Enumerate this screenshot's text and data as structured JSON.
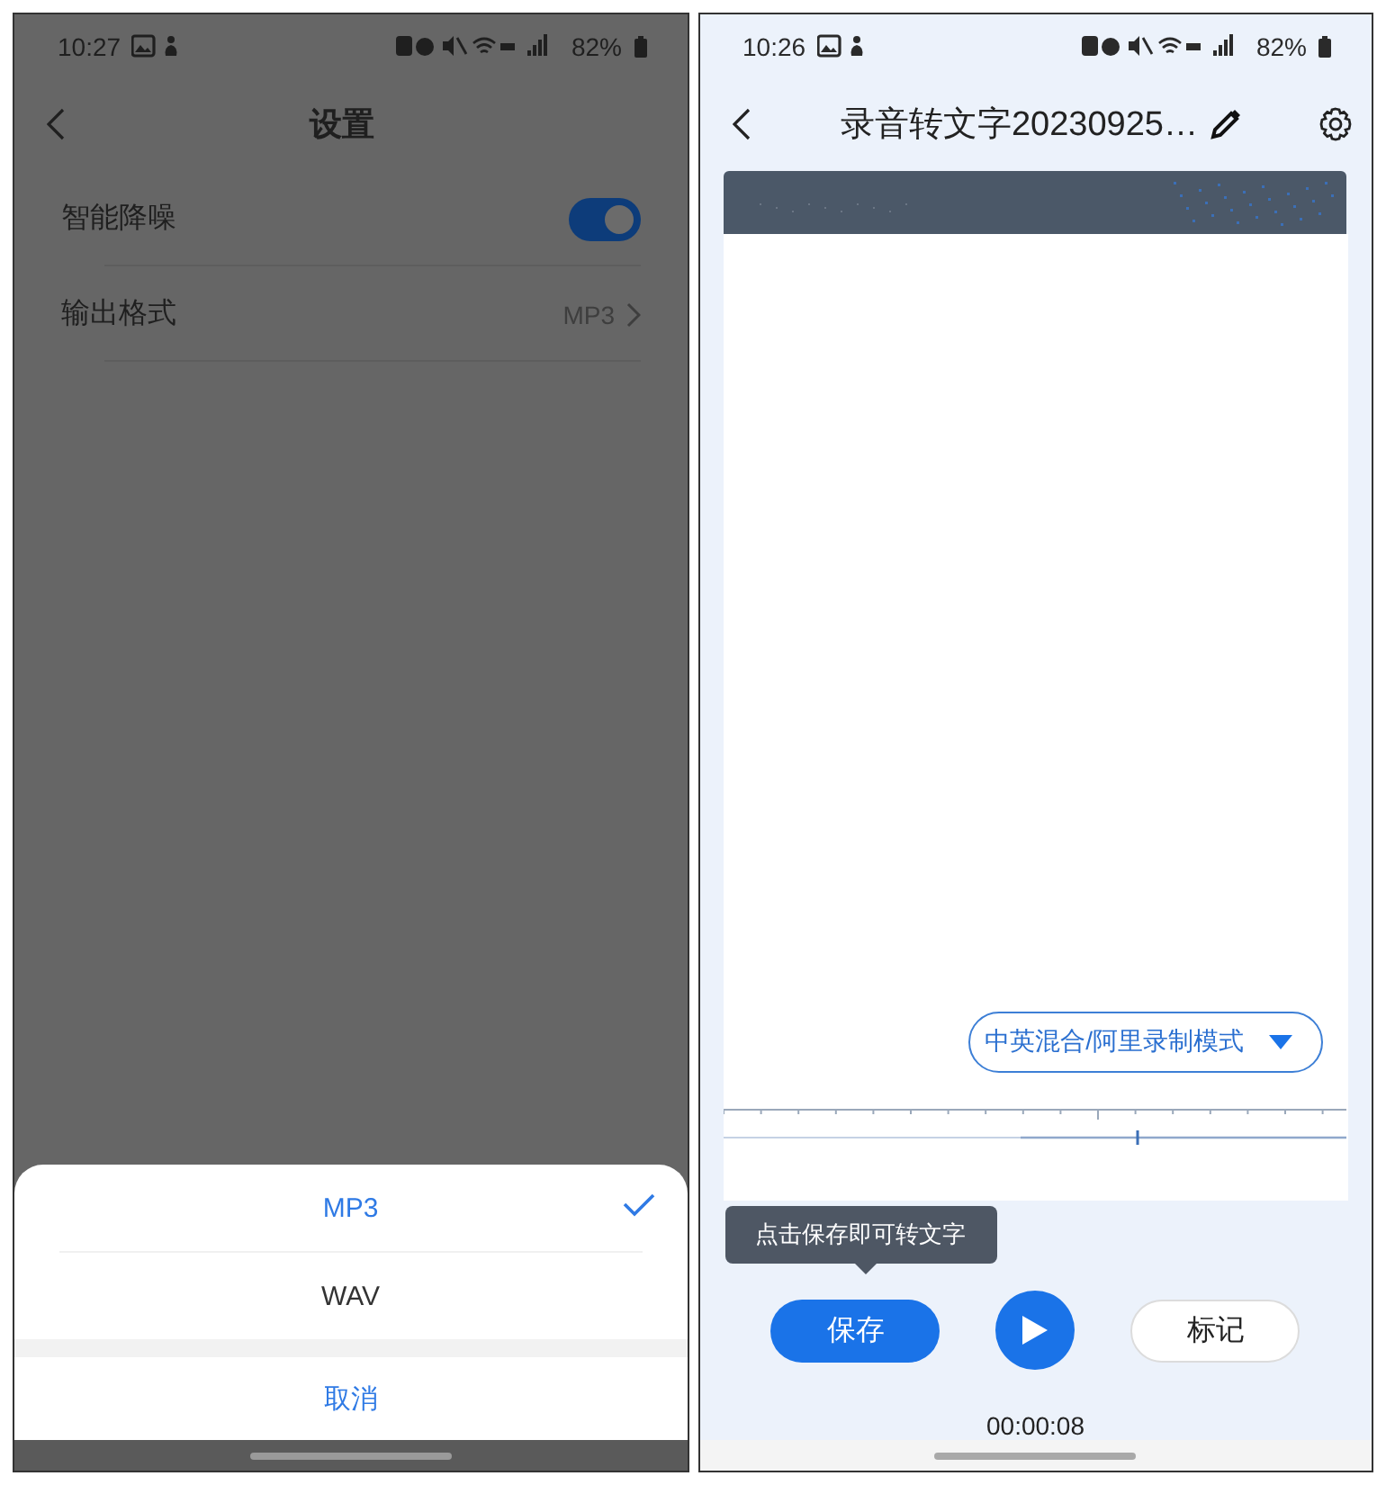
{
  "settings_screen": {
    "status_bar": {
      "time": "10:27",
      "battery": "82%"
    },
    "header": {
      "title": "设置"
    },
    "settings": [
      {
        "kind": "toggle",
        "label": "智能降噪",
        "on": true
      },
      {
        "kind": "value",
        "label": "输出格式",
        "value": "MP3"
      }
    ],
    "format_sheet": {
      "options": [
        {
          "label": "MP3",
          "selected": true
        },
        {
          "label": "WAV",
          "selected": false
        }
      ],
      "cancel": "取消"
    }
  },
  "recorder_screen": {
    "status_bar": {
      "time": "10:26",
      "battery": "82%"
    },
    "header": {
      "title": "录音转文字20230925…"
    },
    "mode_selector": "中英混合/阿里录制模式",
    "tooltip": "点击保存即可转文字",
    "save_button": "保存",
    "mark_button": "标记",
    "elapsed": "00:00:08"
  }
}
